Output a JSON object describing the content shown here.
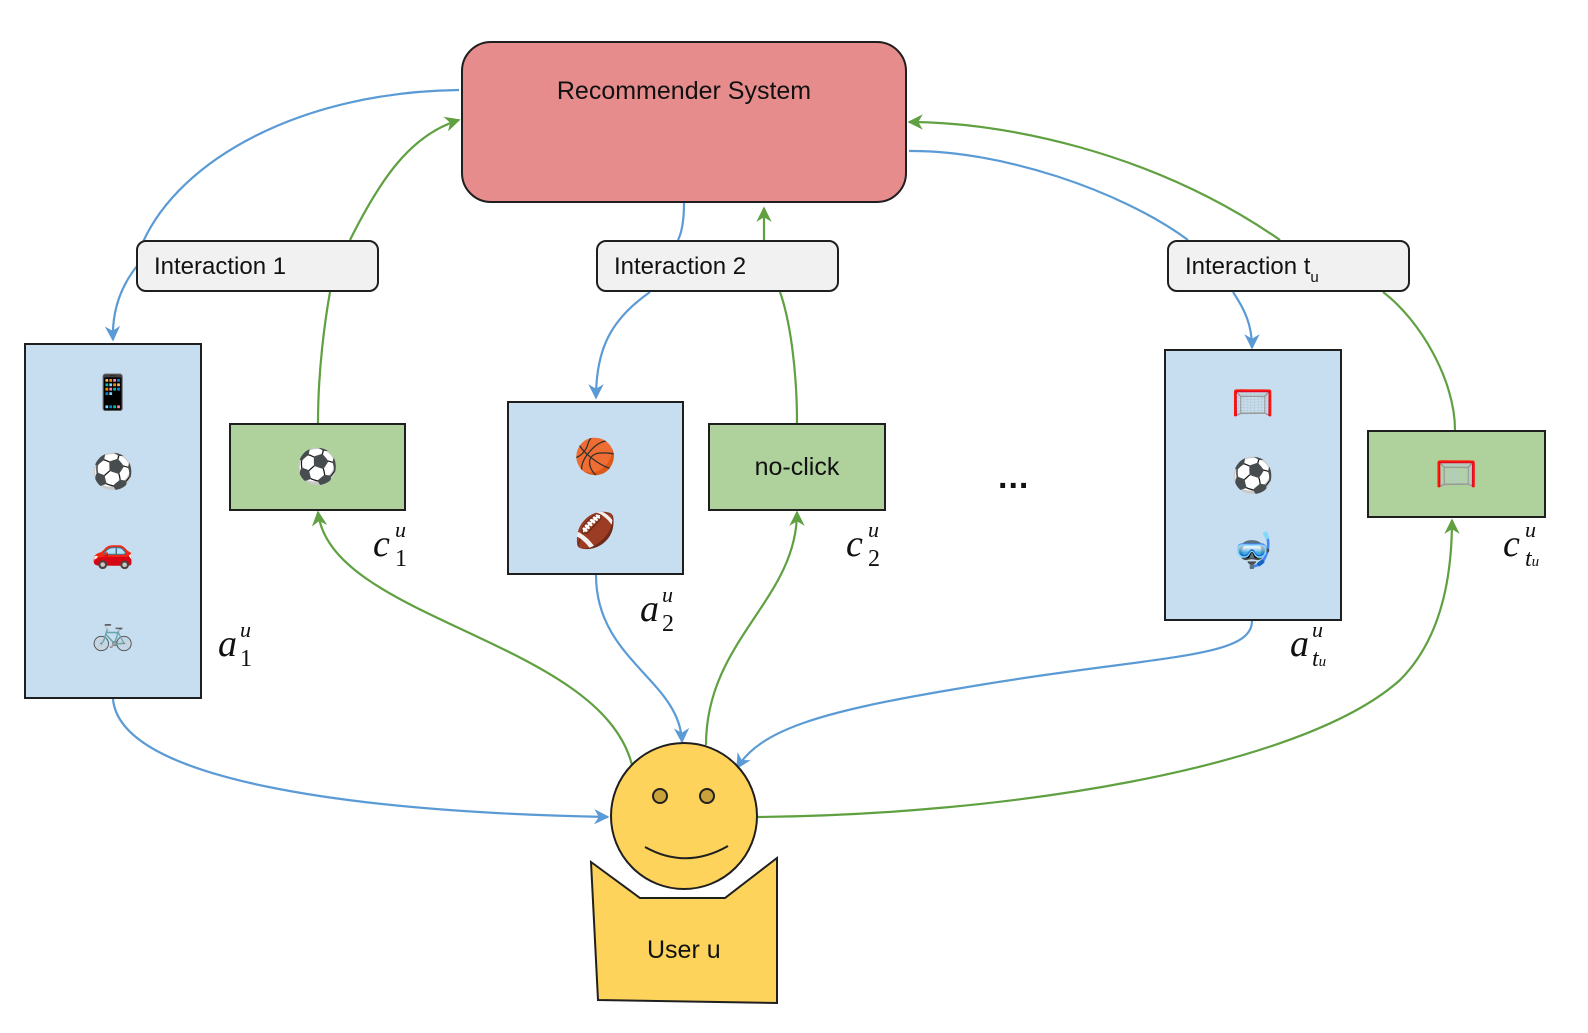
{
  "diagram": {
    "system": {
      "label": "Recommender System",
      "color": "#e68c8c"
    },
    "interactions": [
      {
        "label": "Interaction 1",
        "label_sub": ""
      },
      {
        "label": "Interaction 2",
        "label_sub": ""
      },
      {
        "label": "Interaction t",
        "label_sub": "u"
      }
    ],
    "slates": [
      {
        "name": "a1",
        "symbol": "a",
        "sup": "u",
        "sub": "1",
        "items": [
          "📱",
          "⚽",
          "🚗",
          "🚲"
        ],
        "item_names": [
          "mobile-phone",
          "soccer-ball",
          "car",
          "bicycle"
        ]
      },
      {
        "name": "a2",
        "symbol": "a",
        "sup": "u",
        "sub": "2",
        "items": [
          "🏀",
          "🏈"
        ],
        "item_names": [
          "basketball",
          "american-football"
        ]
      },
      {
        "name": "atu",
        "symbol": "a",
        "sup": "u",
        "sub": "t",
        "sub_sub": "u",
        "items": [
          "🥅",
          "⚽",
          "🤿"
        ],
        "item_names": [
          "goal-net",
          "soccer-ball",
          "diving-mask"
        ]
      }
    ],
    "clicks": [
      {
        "name": "c1",
        "symbol": "c",
        "sup": "u",
        "sub": "1",
        "content": "⚽",
        "content_name": "soccer-ball"
      },
      {
        "name": "c2",
        "symbol": "c",
        "sup": "u",
        "sub": "2",
        "content": "no-click"
      },
      {
        "name": "ctu",
        "symbol": "c",
        "sup": "u",
        "sub": "t",
        "sub_sub": "u",
        "content": "🥅",
        "content_name": "goal-net"
      }
    ],
    "ellipsis": "...",
    "user": {
      "label": "User u",
      "color": "#fdd35c"
    },
    "colors": {
      "recommendation_arrow": "#5b9bd5",
      "feedback_arrow": "#5fa040",
      "slate_fill": "#c7ddf0",
      "click_fill": "#afd19c",
      "interaction_fill": "#f1f1f1"
    }
  }
}
